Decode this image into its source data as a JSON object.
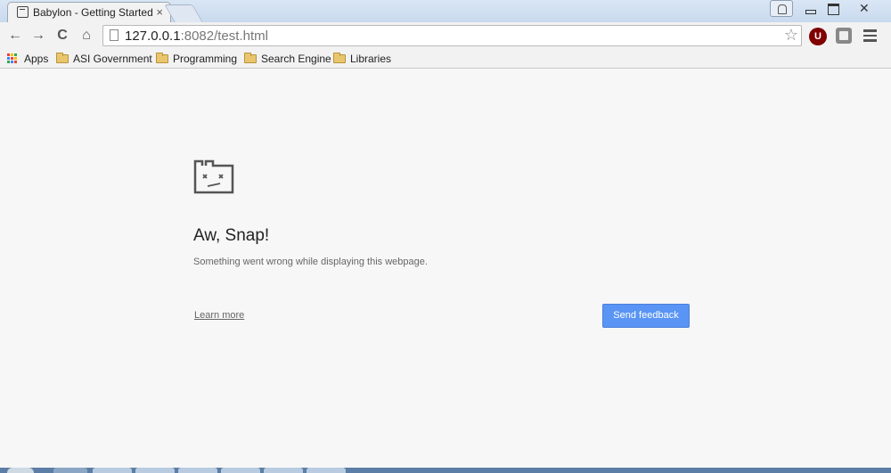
{
  "window": {
    "tab_title": "Babylon - Getting Started",
    "tab_close": "×"
  },
  "toolbar": {
    "back": "←",
    "forward": "→",
    "reload": "C",
    "home": "⌂",
    "url_host": "127.0.0.1",
    "url_rest": ":8082/test.html",
    "star": "☆",
    "extension_u": "U"
  },
  "bookmarks": {
    "items": [
      {
        "label": "Apps",
        "type": "apps"
      },
      {
        "label": "ASI Government",
        "type": "folder"
      },
      {
        "label": "Programming",
        "type": "folder"
      },
      {
        "label": "Search Engine",
        "type": "folder"
      },
      {
        "label": "Libraries",
        "type": "folder"
      }
    ]
  },
  "error_page": {
    "title": "Aw, Snap!",
    "message": "Something went wrong while displaying this webpage.",
    "learn_more": "Learn more",
    "send_feedback": "Send feedback"
  },
  "colors": {
    "accent_button": "#5a95f5",
    "extension_u": "#800000",
    "folder": "#e9c66e"
  }
}
